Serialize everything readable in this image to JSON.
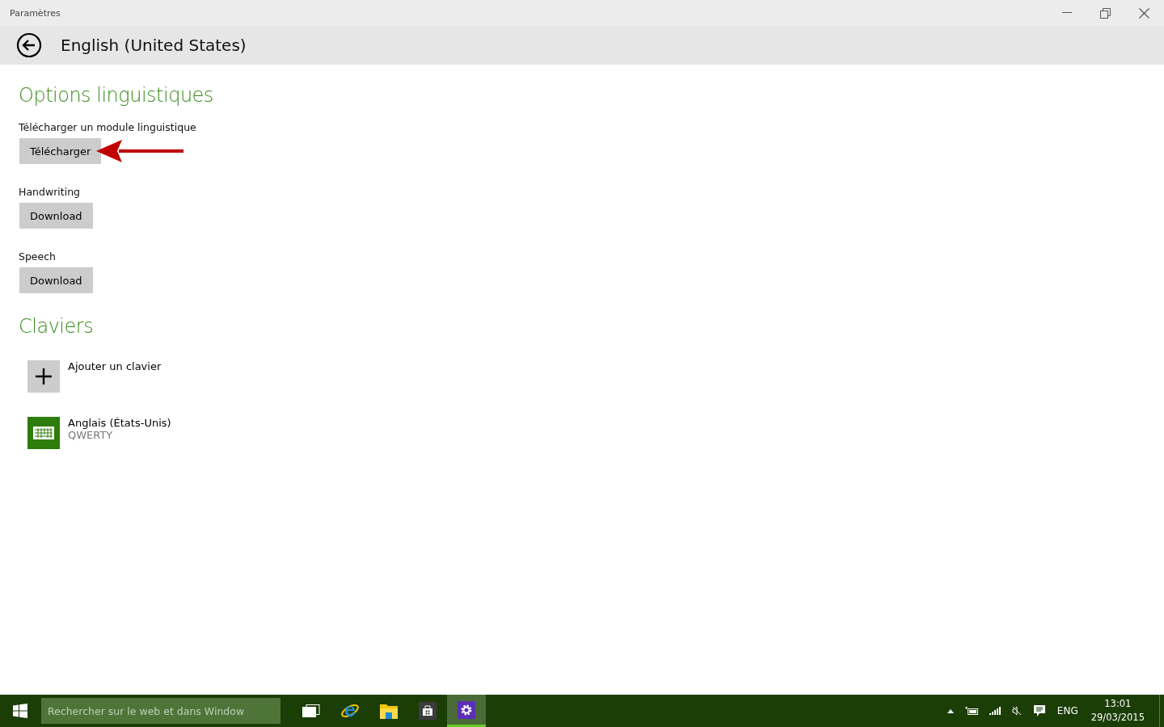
{
  "window": {
    "title": "Paramètres"
  },
  "header": {
    "title": "English (United States)"
  },
  "sections": [
    {
      "heading": "Options linguistiques",
      "options": [
        {
          "label": "Télécharger un module linguistique",
          "button": "Télécharger",
          "annotated": true
        },
        {
          "label": "Handwriting",
          "button": "Download",
          "annotated": false
        },
        {
          "label": "Speech",
          "button": "Download",
          "annotated": false
        }
      ]
    },
    {
      "heading": "Claviers",
      "keyboards": [
        {
          "kind": "add",
          "name": "Ajouter un clavier"
        },
        {
          "kind": "keyboard",
          "name": "Anglais (États-Unis)",
          "layout": "QWERTY"
        }
      ]
    }
  ],
  "taskbar": {
    "search": {
      "placeholder": "Rechercher sur le web et dans Window"
    },
    "apps": [
      {
        "kind": "task-view",
        "selected": false
      },
      {
        "kind": "browser",
        "selected": false
      },
      {
        "kind": "explorer",
        "selected": false
      },
      {
        "kind": "store",
        "selected": false
      },
      {
        "kind": "settings",
        "selected": true
      }
    ],
    "language": "ENG",
    "time": "13:01",
    "date": "29/03/2015"
  }
}
